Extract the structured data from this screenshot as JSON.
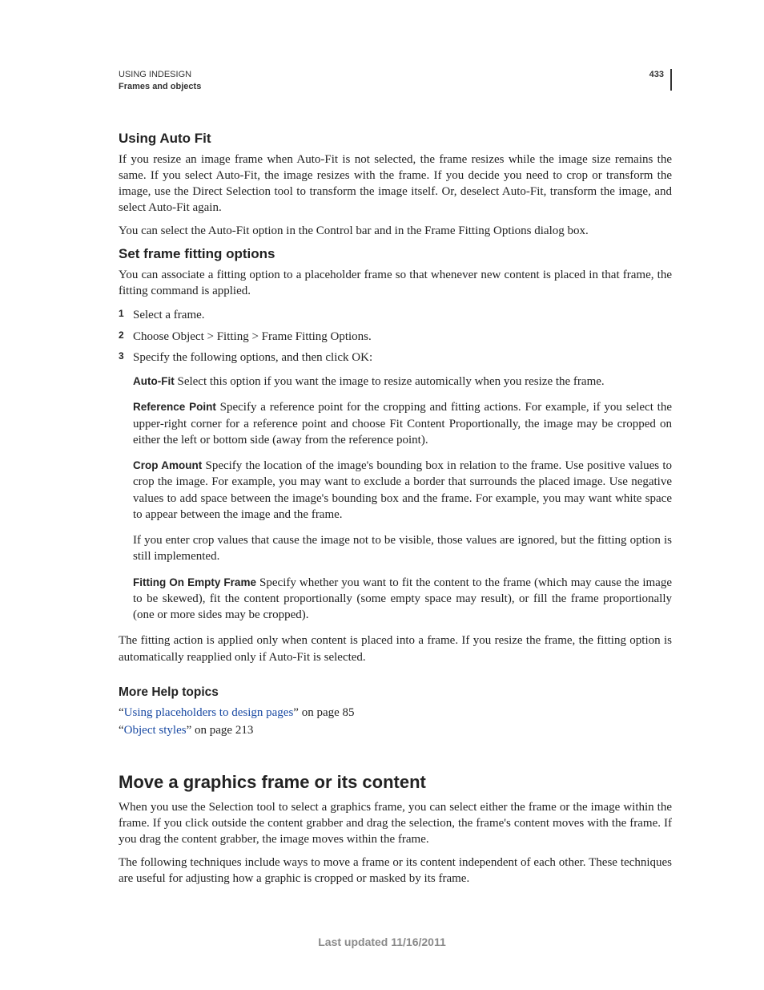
{
  "header": {
    "line1": "USING INDESIGN",
    "line2": "Frames and objects",
    "page_number": "433"
  },
  "sec1": {
    "heading": "Using Auto Fit",
    "p1": "If you resize an image frame when Auto-Fit is not selected, the frame resizes while the image size remains the same. If you select Auto-Fit, the image resizes with the frame. If you decide you need to crop or transform the image, use the Direct Selection tool to transform the image itself. Or, deselect Auto-Fit, transform the image, and select Auto-Fit again.",
    "p2": "You can select the Auto-Fit option in the Control bar and in the Frame Fitting Options dialog box."
  },
  "sec2": {
    "heading": "Set frame fitting options",
    "intro": "You can associate a fitting option to a placeholder frame so that whenever new content is placed in that frame, the fitting command is applied.",
    "steps": {
      "s1": "Select a frame.",
      "s2": "Choose Object > Fitting > Frame Fitting Options.",
      "s3": "Specify the following options, and then click OK:"
    },
    "opts": {
      "autofit_term": "Auto-Fit",
      "autofit_txt": "  Select this option if you want the image to resize automically when you resize the frame.",
      "ref_term": "Reference Point",
      "ref_txt": "  Specify a reference point for the cropping and fitting actions. For example, if you select the upper-right corner for a reference point and choose Fit Content Proportionally, the image may be cropped on either the left or bottom side (away from the reference point).",
      "crop_term": "Crop Amount",
      "crop_txt": "  Specify the location of the image's bounding box in relation to the frame. Use positive values to crop the image. For example, you may want to exclude a border that surrounds the placed image. Use negative values to add space between the image's bounding box and the frame. For example, you may want white space to appear between the image and the frame.",
      "crop_note": "If you enter crop values that cause the image not to be visible, those values are ignored, but the fitting option is still implemented.",
      "fit_term": "Fitting On Empty Frame",
      "fit_txt": "  Specify whether you want to fit the content to the frame (which may cause the image to be skewed), fit the content proportionally (some empty space may result), or fill the frame proportionally (one or more sides may be cropped)."
    },
    "outro": "The fitting action is applied only when content is placed into a frame. If you resize the frame, the fitting option is automatically reapplied only if Auto-Fit is selected."
  },
  "help": {
    "heading": "More Help topics",
    "q_open": "“",
    "q_close": "”",
    "l1_link": "Using placeholders to design pages",
    "l1_tail": " on page 85",
    "l2_link": "Object styles",
    "l2_tail": " on page 213"
  },
  "sec3": {
    "heading": "Move a graphics frame or its content",
    "p1": "When you use the Selection tool to select a graphics frame, you can select either the frame or the image within the frame. If you click outside the content grabber and drag the selection, the frame's content moves with the frame. If you drag the content grabber, the image moves within the frame.",
    "p2": "The following techniques include ways to move a frame or its content independent of each other. These techniques are useful for adjusting how a graphic is cropped or masked by its frame."
  },
  "footer": "Last updated 11/16/2011"
}
